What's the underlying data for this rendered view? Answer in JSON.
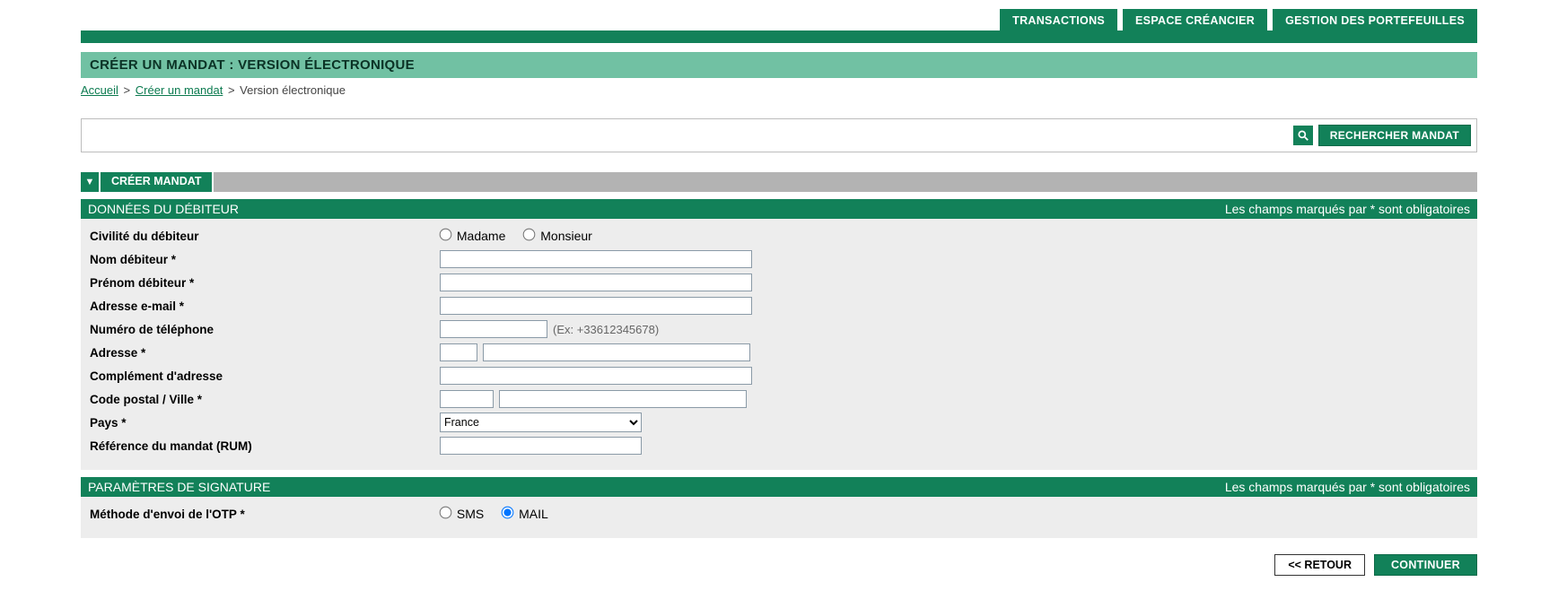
{
  "tabs": {
    "transactions": "TRANSACTIONS",
    "espace": "ESPACE CRÉANCIER",
    "gestion": "GESTION DES PORTEFEUILLES"
  },
  "title": "CRÉER UN MANDAT : VERSION ÉLECTRONIQUE",
  "breadcrumbs": {
    "home": "Accueil",
    "create": "Créer un mandat",
    "current": "Version électronique"
  },
  "search": {
    "button": "RECHERCHER MANDAT"
  },
  "sectab": {
    "label": "CRÉER MANDAT"
  },
  "sections": {
    "debiteur": {
      "title": "DONNÉES DU DÉBITEUR",
      "req": "Les champs marqués par * sont obligatoires"
    },
    "signature": {
      "title": "PARAMÈTRES DE SIGNATURE",
      "req": "Les champs marqués par * sont obligatoires"
    }
  },
  "labels": {
    "civilite": "Civilité du débiteur",
    "madame": "Madame",
    "monsieur": "Monsieur",
    "nom": "Nom débiteur *",
    "prenom": "Prénom débiteur *",
    "email": "Adresse e-mail *",
    "tel": "Numéro de téléphone",
    "tel_hint": "(Ex: +33612345678)",
    "adresse": "Adresse *",
    "compl": "Complément d'adresse",
    "cpville": "Code postal / Ville *",
    "pays": "Pays *",
    "rum": "Référence du mandat (RUM)",
    "otp": "Méthode d'envoi de l'OTP *",
    "sms": "SMS",
    "mail": "MAIL"
  },
  "values": {
    "pays_selected": "France"
  },
  "buttons": {
    "back": "<< RETOUR",
    "continue": "CONTINUER"
  }
}
